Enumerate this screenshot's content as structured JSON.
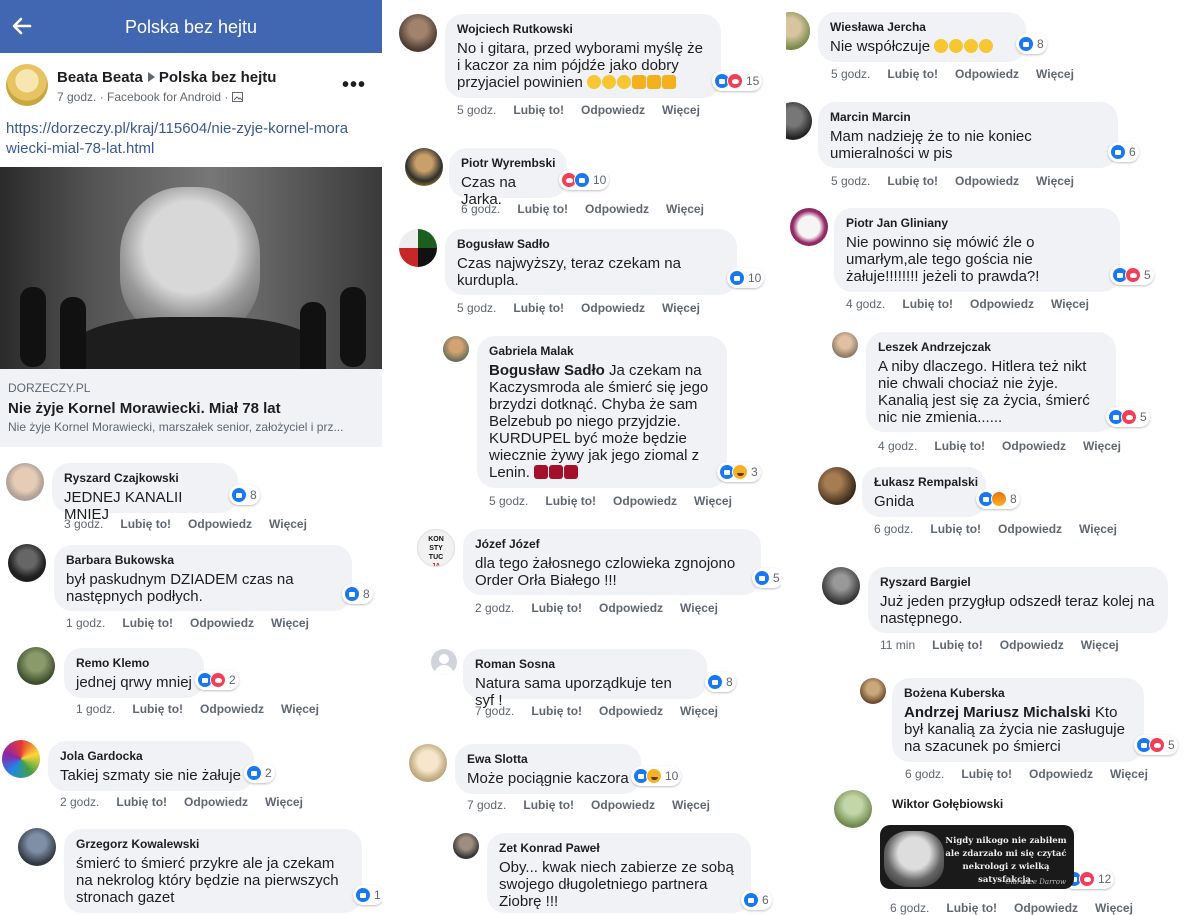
{
  "header": {
    "title": "Polska bez hejtu"
  },
  "post": {
    "author": "Beata Beata",
    "group": "Polska bez hejtu",
    "meta": "7 godz. · Facebook for Android ·",
    "link_url": "https://dorzeczy.pl/kraj/115604/nie-zyje-kornel-morawiecki-mial-78-lat.html",
    "domain": "DORZECZY.PL",
    "link_title": "Nie żyje Kornel Morawiecki. Miał 78 lat",
    "link_desc": "Nie żyje Kornel Morawiecki, marszałek senior, założyciel i prz..."
  },
  "labels": {
    "like": "Lubię to!",
    "reply": "Odpowiedz",
    "more": "Więcej"
  },
  "comments": [
    {
      "name": "Ryszard Czajkowski",
      "text": "JEDNEJ KANALII MNIEJ",
      "time": "3 godz.",
      "count": "8"
    },
    {
      "name": "Barbara Bukowska",
      "text": "był paskudnym DZIADEM czas na następnych podłych.",
      "time": "1 godz.",
      "count": "8"
    },
    {
      "name": "Remo Klemo",
      "text": "jednej qrwy mniej",
      "time": "1 godz.",
      "count": "2"
    },
    {
      "name": "Jola Gardocka",
      "text": "Takiej szmaty sie nie żałuje",
      "time": "2 godz.",
      "count": "2"
    },
    {
      "name": "Grzegorz Kowalewski",
      "text": "śmierć to śmierć przykre ale ja czekam na nekrolog który będzie na pierwszych stronach gazet",
      "time": "",
      "count": "1"
    },
    {
      "name": "Wojciech Rutkowski",
      "text": "No i gitara, przed wyborami myślę że i kaczor za nim pójdźe jako dobry przyjaciel powinien",
      "time": "5 godz.",
      "count": "15"
    },
    {
      "name": "Piotr Wyrembski",
      "text": "Czas na Jarka.",
      "time": "6 godz.",
      "count": "10"
    },
    {
      "name": "Bogusław Sadło",
      "text": "Czas najwyższy, teraz czekam na kurdupla.",
      "time": "5 godz.",
      "count": "10"
    },
    {
      "name": "Gabriela Malak",
      "mention": "Bogusław Sadło",
      "text": "Ja czekam na Kaczysmroda ale śmierć się jego brzydzi dotknąć. Chyba że sam Belzebub po niego przyjdzie. KURDUPEL być może będzie wiecznie żywy jak jego ziomal z Lenin.",
      "time": "5 godz.",
      "count": "3"
    },
    {
      "name": "Józef Józef",
      "text": "dla tego żałosnego czlowieka zgnojono Order Orła Białego !!!",
      "time": "2 godz.",
      "count": "5"
    },
    {
      "name": "Roman Sosna",
      "text": "Natura sama uporządkuje ten syf !",
      "time": "7 godz.",
      "count": "8"
    },
    {
      "name": "Ewa Slotta",
      "text": "Może pociągnie kaczora",
      "time": "7 godz.",
      "count": "10"
    },
    {
      "name": "Zet Konrad Paweł",
      "text": "Oby... kwak niech zabierze ze sobą swojego długoletniego partnera Ziobrę !!!",
      "time": "",
      "count": "6"
    },
    {
      "name": "Wiesława Jercha",
      "text": "Nie współczuje",
      "time": "5 godz.",
      "count": "8"
    },
    {
      "name": "Marcin Marcin",
      "text": "Mam nadzieję że to nie koniec umieralności w pis",
      "time": "5 godz.",
      "count": "6"
    },
    {
      "name": "Piotr Jan Gliniany",
      "text": "Nie powinno się mówić źle o umarłym,ale tego gościa nie żałuje!!!!!!!! jeżeli to prawda?!",
      "time": "4 godz.",
      "count": "5"
    },
    {
      "name": "Leszek Andrzejczak",
      "text": "A niby dlaczego. Hitlera też nikt nie chwali chociaż nie żyje. Kanalią jest się za życia, śmierć nic nie zmienia......",
      "time": "4 godz.",
      "count": "5"
    },
    {
      "name": "Łukasz Rempalski",
      "text": "Gnida",
      "time": "6 godz.",
      "count": "8"
    },
    {
      "name": "Ryszard Bargiel",
      "text": "Już jeden przygłup odszedł teraz kolej na następnego.",
      "time": "11 min",
      "count": ""
    },
    {
      "name": "Bożena Kuberska",
      "mention": "Andrzej Mariusz Michalski",
      "text": "Kto był kanalią za życia nie zasługuje na szacunek po śmierci",
      "time": "6 godz.",
      "count": "5"
    },
    {
      "name": "Wiktor Gołębiowski",
      "text": "",
      "time": "6 godz.",
      "count": "12"
    }
  ],
  "image_quote": "Nigdy nikogo nie zabiłem ale zdarzało mi się czytać nekrologi z wielką satysfakcją.",
  "image_sig": "Clarence Darrow"
}
